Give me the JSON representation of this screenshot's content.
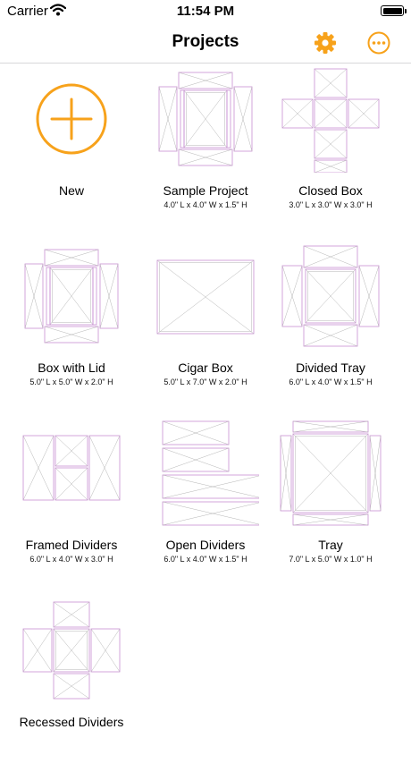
{
  "status_bar": {
    "carrier": "Carrier",
    "time": "11:54 PM",
    "battery_level": 1.0
  },
  "nav": {
    "title": "Projects",
    "actions": [
      {
        "icon": "gear-icon"
      },
      {
        "icon": "more-icon"
      }
    ]
  },
  "colors": {
    "accent": "#F7A21B",
    "outline_purple": "#C98ED3",
    "outline_gray": "#B5B5B5",
    "separator": "#D7D7D9"
  },
  "projects": [
    {
      "name": "New",
      "dims": "",
      "icon": "add-icon"
    },
    {
      "name": "Sample Project",
      "dims": "4.0\" L x 4.0\" W x 1.5\" H",
      "icon": "box-with-lid-layout"
    },
    {
      "name": "Closed Box",
      "dims": "3.0\" L x 3.0\" W x 3.0\" H",
      "icon": "closed-box-layout"
    },
    {
      "name": "Box with Lid",
      "dims": "5.0\" L x 5.0\" W x 2.0\" H",
      "icon": "box-with-lid-layout"
    },
    {
      "name": "Cigar Box",
      "dims": "5.0\" L x 7.0\" W x 2.0\" H",
      "icon": "cigar-box-layout"
    },
    {
      "name": "Divided Tray",
      "dims": "6.0\" L x 4.0\" W x 1.5\" H",
      "icon": "divided-tray-layout"
    },
    {
      "name": "Framed Dividers",
      "dims": "6.0\" L x 4.0\" W x 3.0\" H",
      "icon": "framed-dividers-layout"
    },
    {
      "name": "Open Dividers",
      "dims": "6.0\" L x 4.0\" W x 1.5\" H",
      "icon": "open-dividers-layout"
    },
    {
      "name": "Tray",
      "dims": "7.0\" L x 5.0\" W x 1.0\" H",
      "icon": "tray-layout"
    },
    {
      "name": "Recessed Dividers",
      "dims": "",
      "icon": "recessed-dividers-layout"
    }
  ]
}
